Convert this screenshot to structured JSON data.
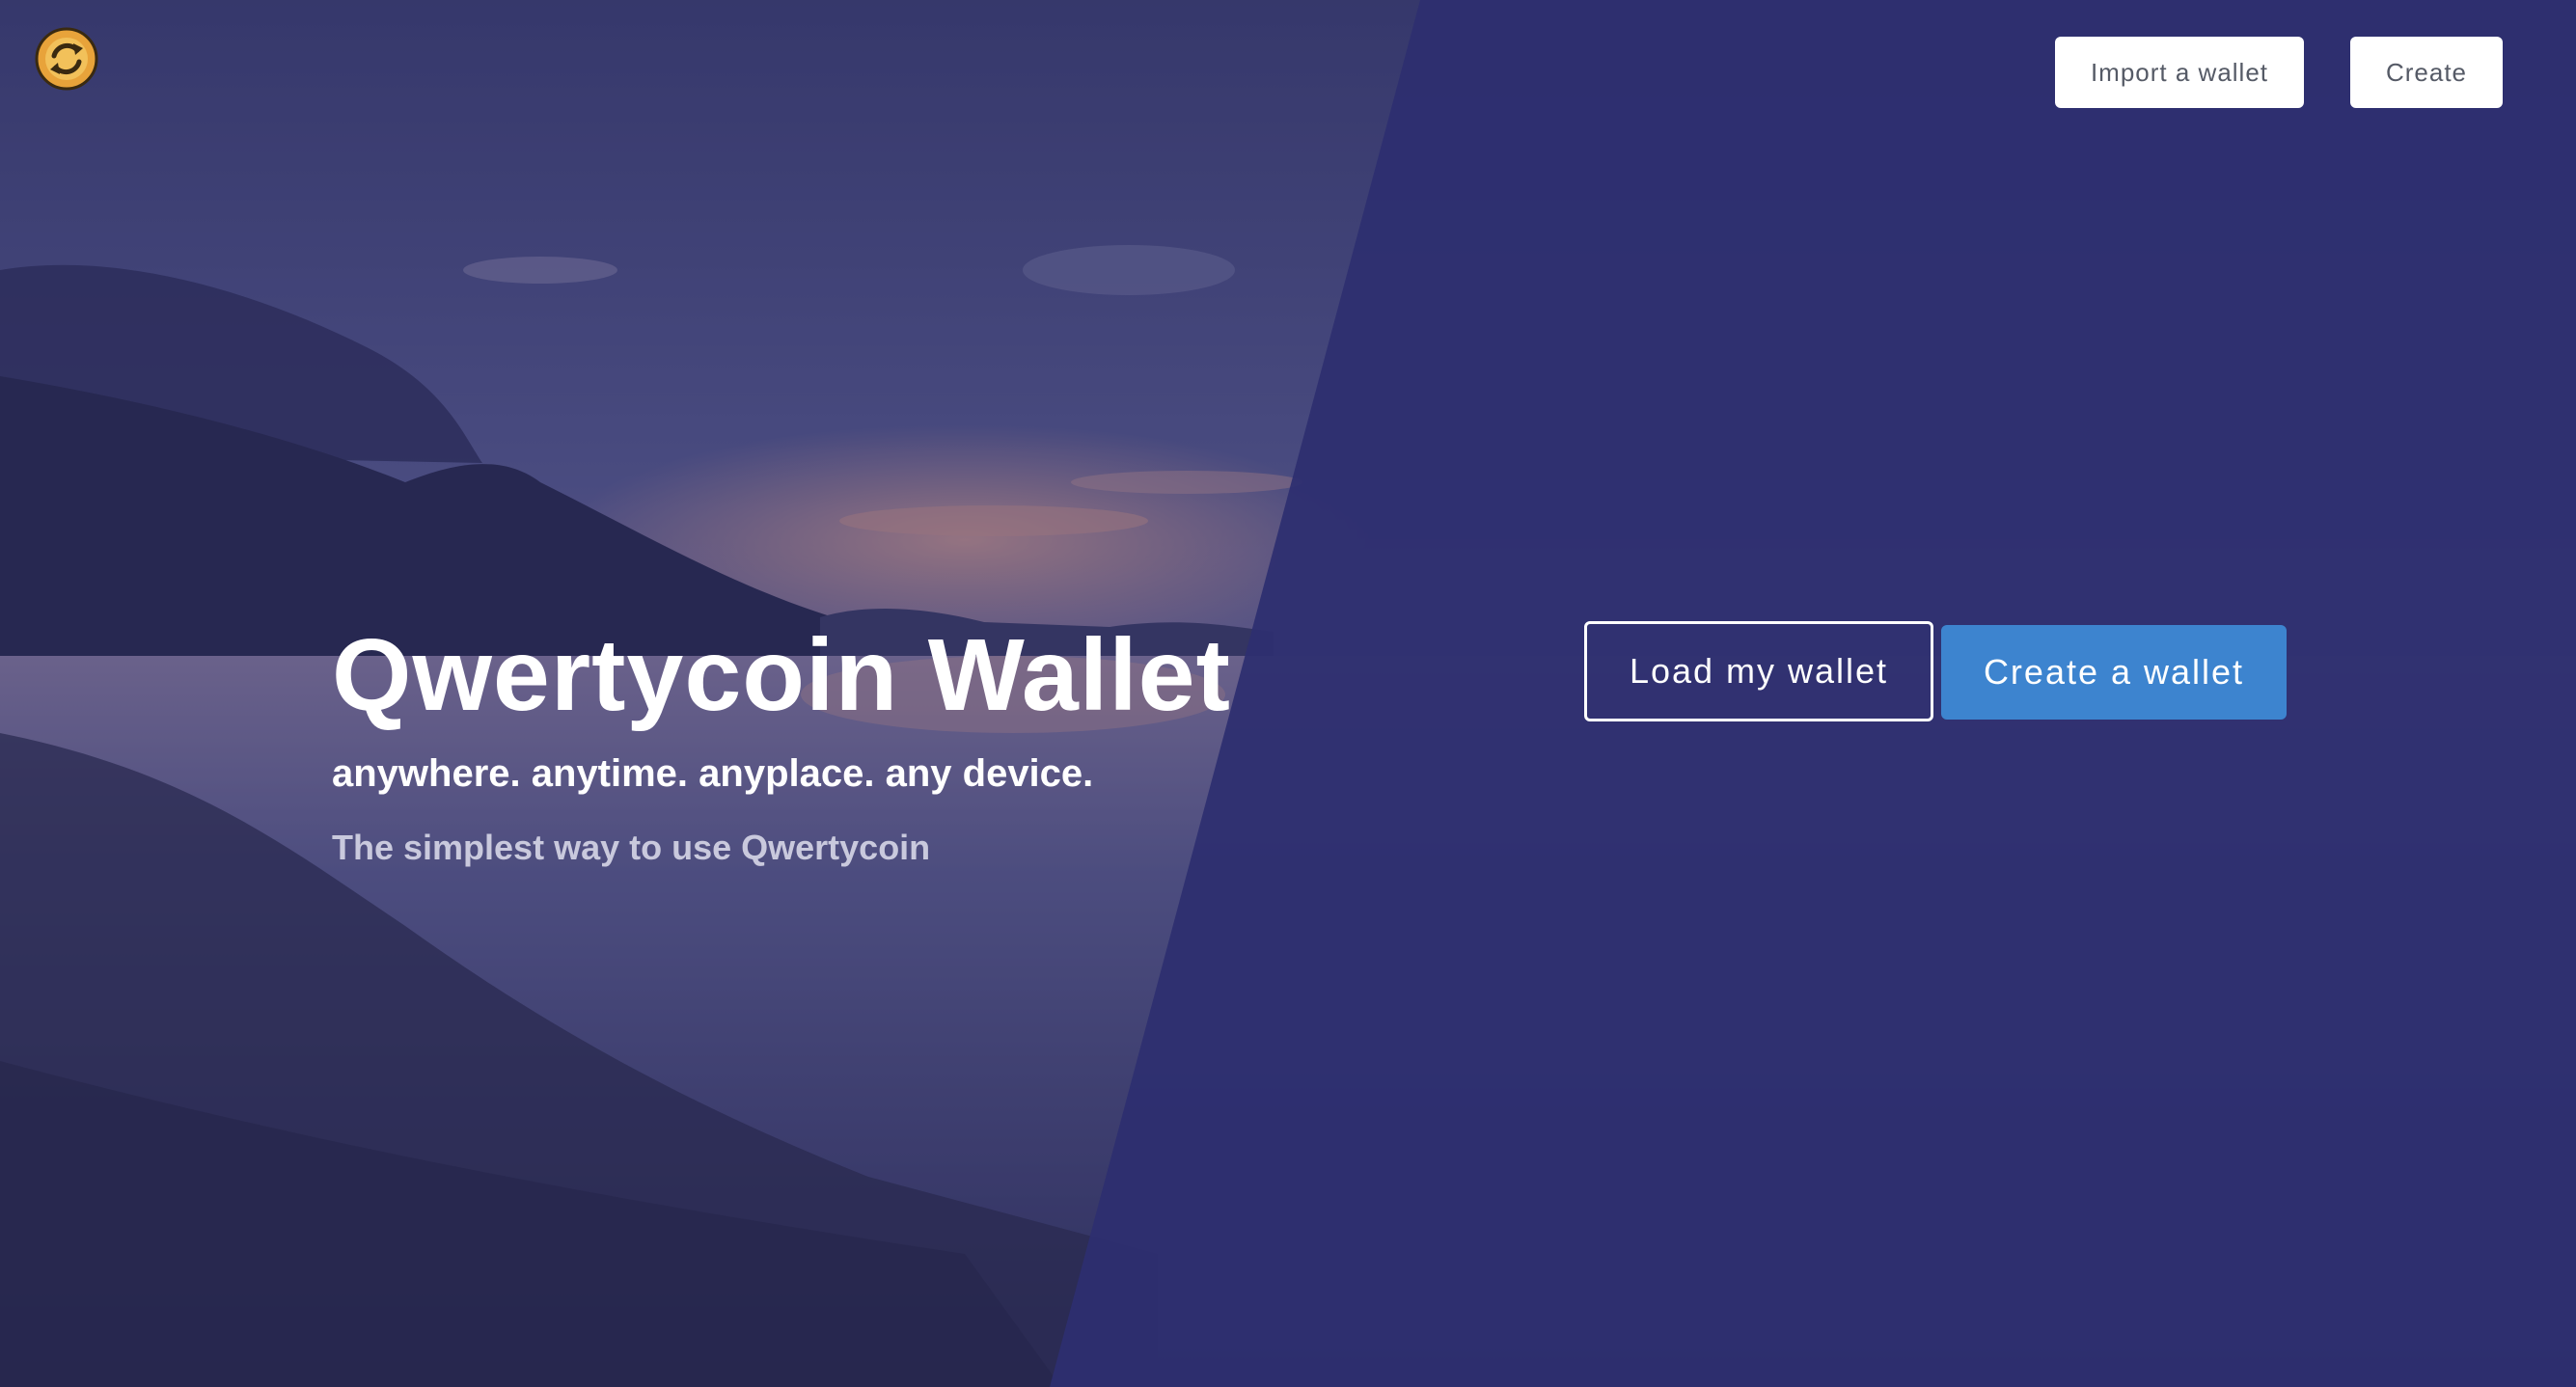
{
  "header": {
    "logo_icon": "qwertycoin-logo-icon",
    "import_label": "Import a wallet",
    "create_label": "Create"
  },
  "hero": {
    "title": "Qwertycoin Wallet",
    "subtitle": "anywhere. anytime. anyplace. any device.",
    "tagline": "The simplest way to use Qwertycoin"
  },
  "actions": {
    "load_label": "Load my wallet",
    "create_label": "Create a wallet"
  },
  "colors": {
    "overlay": "#2c2d6b",
    "primary_button": "#3d84cf",
    "logo_gold": "#e8a33a"
  }
}
